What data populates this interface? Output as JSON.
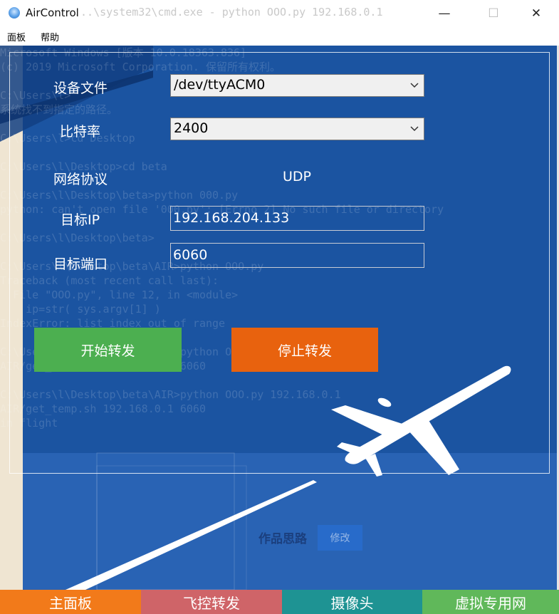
{
  "window": {
    "title": "AirControl",
    "background_title": "...\\system32\\cmd.exe - python OOO.py 192.168.0.1",
    "minimize_glyph": "—",
    "maximize_glyph": "☐",
    "close_glyph": "✕"
  },
  "menu": {
    "items": [
      "面板",
      "帮助"
    ]
  },
  "background_console": [
    "Microsoft Windows [版本 10.0.18363.836]",
    "(c) 2019 Microsoft Corporation. 保留所有权利。",
    "",
    "C:\\Users\\l>",
    "系统找不到指定的路径。",
    "",
    "C:\\Users\\l>cd Desktop",
    "",
    "C:\\Users\\l\\Desktop>cd beta",
    "",
    "C:\\Users\\l\\Desktop\\beta>python 000.py",
    "python: can't open file '000.py': [Errno 2] No such file or directory",
    "",
    "C:\\Users\\l\\Desktop\\beta>",
    "",
    "C:\\Users\\l\\Desktop\\beta\\AIR>python OOO.py",
    "Traceback (most recent call last):",
    "  File \"OOO.py\", line 12, in <module>",
    "    ip=str( sys.argv[1] )",
    "IndexError: list index out of range",
    "",
    "C:\\Users\\l\\Desktop\\beta\\AIR>python OOO.py 192.168.0.1",
    "AIR/get_temp.sh 192.168.0.1 6060",
    "",
    "C:\\Users\\l\\Desktop\\beta\\AIR>python OOO.py 192.168.0.1",
    "AIR/get_temp.sh 192.168.0.1 6060",
    "in flight"
  ],
  "background_section": {
    "label": "作品思路",
    "button": "修改"
  },
  "form": {
    "device": {
      "label": "设备文件",
      "value": "/dev/ttyACM0"
    },
    "baud": {
      "label": "比特率",
      "value": "2400"
    },
    "protocol": {
      "label": "网络协议",
      "value": "UDP"
    },
    "target_ip": {
      "label": "目标IP",
      "value": "192.168.204.133"
    },
    "target_port": {
      "label": "目标端口",
      "value": "6060"
    }
  },
  "actions": {
    "start": {
      "label": "开始转发",
      "color": "#4caf50"
    },
    "stop": {
      "label": "停止转发",
      "color": "#e8620e"
    }
  },
  "tabs": [
    {
      "label": "主面板",
      "color": "#f27a1a",
      "text_color": "#ffffff"
    },
    {
      "label": "飞控转发",
      "color": "#cf6468",
      "text_color": "#ffffff"
    },
    {
      "label": "摄像头",
      "color": "#1e9393",
      "text_color": "#ffffff"
    },
    {
      "label": "虚拟专用网",
      "color": "#60b85a",
      "text_color": "#ffffff"
    }
  ],
  "colors": {
    "panel_bg": "#1b54a1",
    "lower_bg": "#2963b4",
    "accent_green": "#4caf50",
    "accent_orange": "#e8620e"
  }
}
